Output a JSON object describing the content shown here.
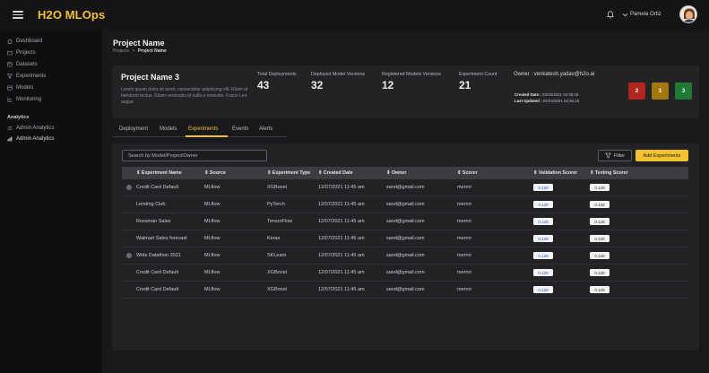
{
  "app": {
    "title": "H2O MLOps"
  },
  "user": {
    "name": "Pamela Ortiz"
  },
  "sidebar": {
    "items": [
      {
        "label": "Dashboard",
        "icon": "home-icon"
      },
      {
        "label": "Projects",
        "icon": "folder-icon"
      },
      {
        "label": "Datasets",
        "icon": "database-icon"
      },
      {
        "label": "Experiments",
        "icon": "filter-icon"
      },
      {
        "label": "Models",
        "icon": "model-icon"
      },
      {
        "label": "Monitoring",
        "icon": "monitor-icon"
      }
    ],
    "section_label": "Analytics",
    "analytics_items": [
      {
        "label": "Admin Analytics",
        "icon": "list-icon"
      },
      {
        "label": "Admin Analytics",
        "icon": "bar-chart-icon"
      }
    ]
  },
  "page": {
    "title": "Project Name",
    "breadcrumb": {
      "parent": "Projects",
      "separator": ">",
      "current": "Project Name"
    }
  },
  "summary": {
    "project_name": "Project Name 3",
    "description": "Lorem ipsum dolor sit amet, consectetur adipiscing elit. Etiam ut hendrerit tectus. Etiam venenatis id nulla a molestie. Fusce Leo augue",
    "stats": [
      {
        "label": "Total Deployments",
        "value": "43"
      },
      {
        "label": "Deployed Model Versions",
        "value": "32"
      },
      {
        "label": "Registered Models Versions",
        "value": "12"
      },
      {
        "label": "Experiment Count",
        "value": "21"
      }
    ],
    "owner_label": "Owner : venkatesh.yadav@h2o.ai",
    "created_label": "Created Date :",
    "created_value": "03/23/2021 04:36:18",
    "updated_label": "Last Updated :",
    "updated_value": "03/23/2021 04:36:18",
    "badges": [
      {
        "value": "2",
        "color": "#b3261e"
      },
      {
        "value": "1",
        "color": "#a0780e"
      },
      {
        "value": "3",
        "color": "#1e7a34"
      }
    ]
  },
  "tabs": [
    "Deployment",
    "Models",
    "Experiments",
    "Events",
    "Alerts"
  ],
  "active_tab": "Experiments",
  "search": {
    "placeholder": "Search by Model/Project/Owner"
  },
  "buttons": {
    "filter": "Filter",
    "add": "Add Experiments"
  },
  "table": {
    "columns": [
      "Experiment Name",
      "Source",
      "Experiment Type",
      "Created Date",
      "Owner",
      "Scorer",
      "Validation Scorer",
      "Testing Scorer"
    ],
    "rows": [
      {
        "name": "Credit Card Default",
        "source": "MLflow",
        "type": "XGBoost",
        "date": "12/07/2021 11:45 am",
        "owner": "sand@gmail.com",
        "scorer": "merror",
        "validation": "0.128",
        "testing": "0.128",
        "radio": true
      },
      {
        "name": "Lending Club",
        "source": "MLflow",
        "type": "PyTorch",
        "date": "12/07/2021 11:45 am",
        "owner": "sand@gmail.com",
        "scorer": "merror",
        "validation": "0.128",
        "testing": "0.128",
        "radio": false
      },
      {
        "name": "Rossman Sales",
        "source": "MLflow",
        "type": "TensorFlow",
        "date": "12/07/2021 11:45 am",
        "owner": "sand@gmail.com",
        "scorer": "merror",
        "validation": "0.128",
        "testing": "0.128",
        "radio": false
      },
      {
        "name": "Walmart Sales forecast",
        "source": "MLflow",
        "type": "Keras",
        "date": "12/07/2021 11:45 am",
        "owner": "sand@gmail.com",
        "scorer": "merror",
        "validation": "0.128",
        "testing": "0.128",
        "radio": false
      },
      {
        "name": "Wids Datathon 2021",
        "source": "MLflow",
        "type": "SKLearn",
        "date": "12/07/2021 11:45 am",
        "owner": "sand@gmail.com",
        "scorer": "merror",
        "validation": "0.128",
        "testing": "0.128",
        "radio": true
      },
      {
        "name": "Credit Card Default",
        "source": "MLflow",
        "type": "XGBoost",
        "date": "12/07/2021 11:45 am",
        "owner": "sand@gmail.com",
        "scorer": "merror",
        "validation": "0.128",
        "testing": "0.128",
        "radio": false
      },
      {
        "name": "Credit Card Default",
        "source": "MLflow",
        "type": "XGBoost",
        "date": "12/07/2021 11:45 am",
        "owner": "sand@gmail.com",
        "scorer": "merror",
        "validation": "0.128",
        "testing": "0.128",
        "radio": false
      }
    ]
  },
  "colors": {
    "accent": "#f2c230",
    "background": "#0b0b0d",
    "panel": "#222225"
  }
}
